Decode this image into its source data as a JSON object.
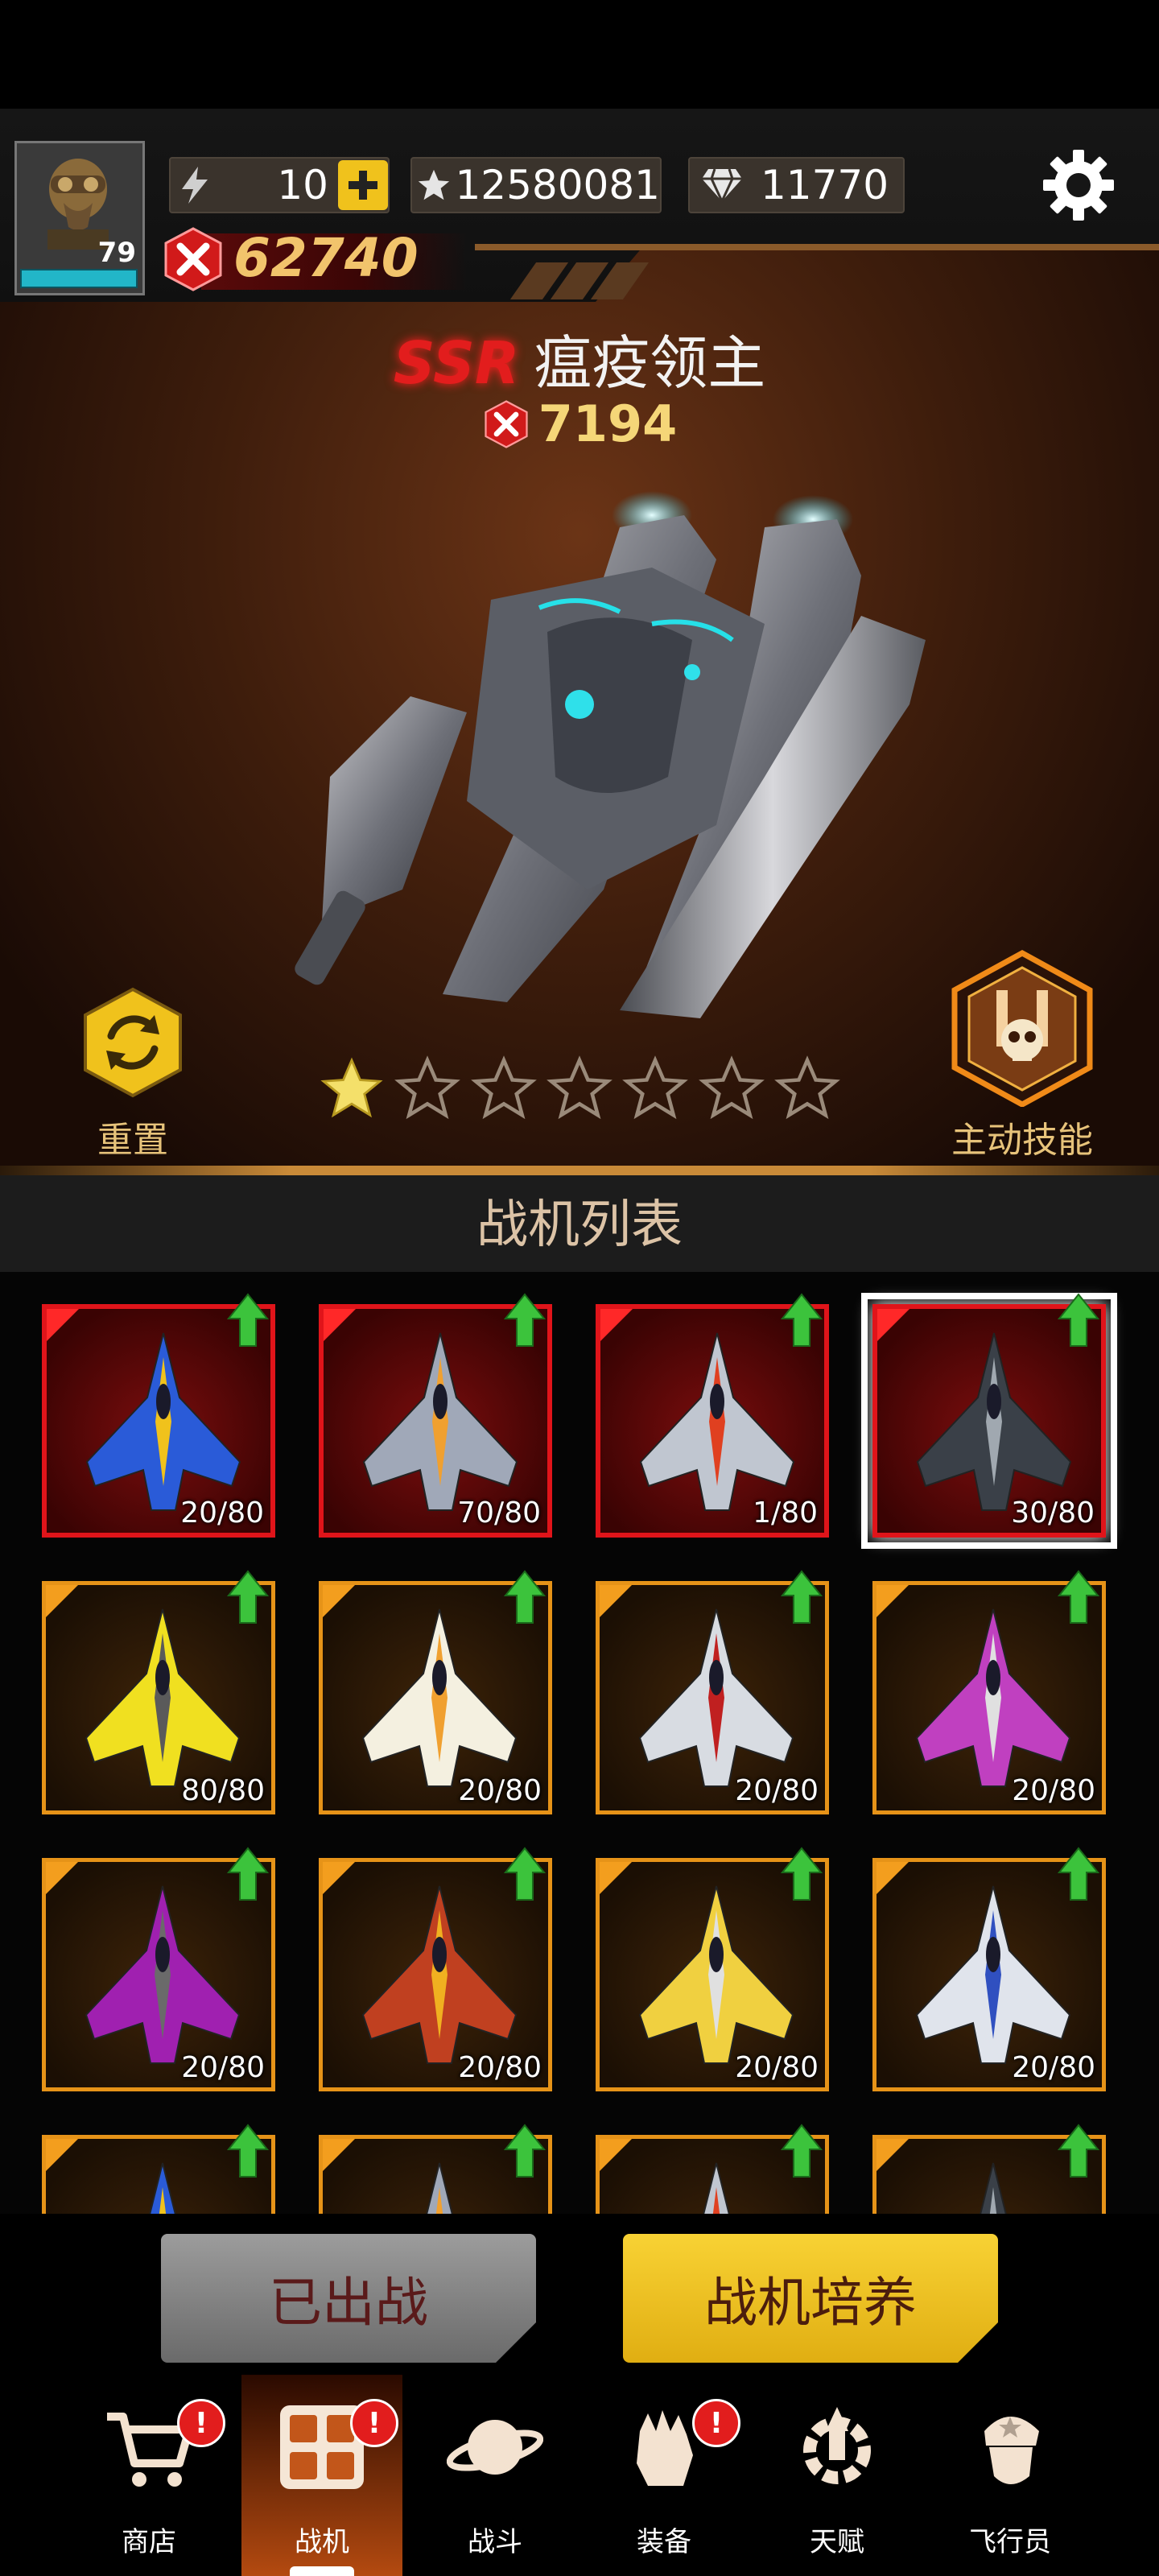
{
  "player": {
    "level": "79",
    "power": "62740"
  },
  "resources": {
    "energy": "10",
    "stars": "12580081",
    "diamonds": "11770"
  },
  "ship": {
    "rarity": "SSR",
    "name": "瘟疫领主",
    "power": "7194",
    "stars_filled": 1,
    "stars_total": 7
  },
  "actions": {
    "reset_label": "重置",
    "skill_label": "主动技能"
  },
  "list": {
    "title": "战机列表",
    "cards": [
      {
        "count": "20/80",
        "tier": "ssr"
      },
      {
        "count": "70/80",
        "tier": "ssr"
      },
      {
        "count": "1/80",
        "tier": "ssr"
      },
      {
        "count": "30/80",
        "tier": "ssr",
        "selected": true
      },
      {
        "count": "80/80",
        "tier": "sr"
      },
      {
        "count": "20/80",
        "tier": "sr"
      },
      {
        "count": "20/80",
        "tier": "sr"
      },
      {
        "count": "20/80",
        "tier": "sr"
      },
      {
        "count": "20/80",
        "tier": "sr"
      },
      {
        "count": "20/80",
        "tier": "sr"
      },
      {
        "count": "20/80",
        "tier": "sr"
      },
      {
        "count": "20/80",
        "tier": "sr"
      }
    ]
  },
  "buttons": {
    "deployed": "已出战",
    "train": "战机培养"
  },
  "nav": {
    "shop": "商店",
    "fighters": "战机",
    "battle": "战斗",
    "equipment": "装备",
    "talent": "天赋",
    "pilot": "飞行员",
    "badge_mark": "!"
  },
  "colors": {
    "accent_gold": "#f0c21c",
    "ssr_red": "#e0141a",
    "sr_orange": "#e69318"
  }
}
